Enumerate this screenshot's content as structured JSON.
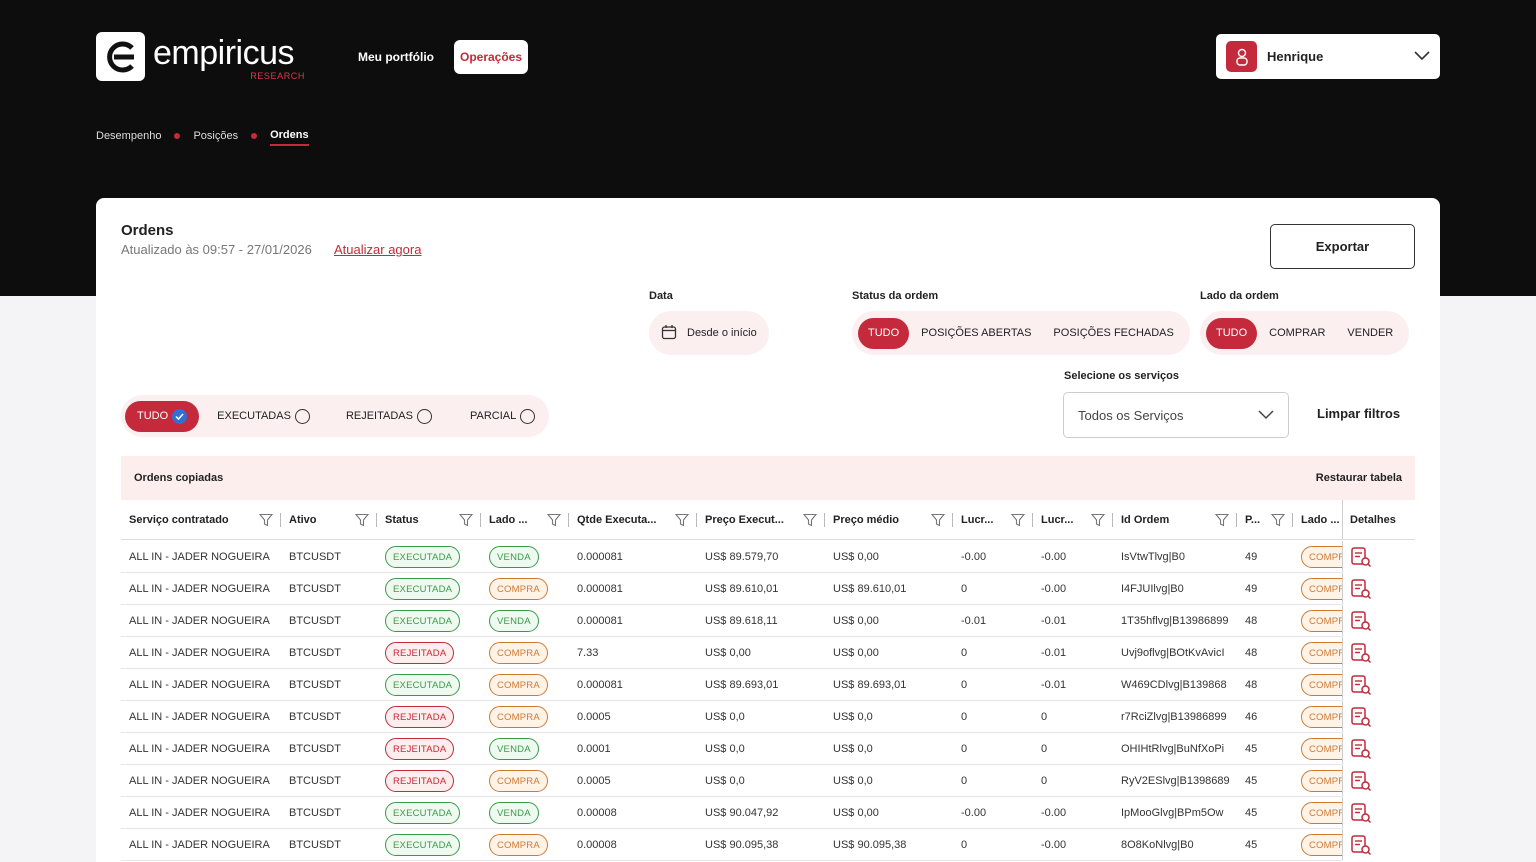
{
  "brand": {
    "name": "empiricus",
    "sub": "RESEARCH",
    "accent": "#c4293c"
  },
  "nav": {
    "portfolio": "Meu portfólio",
    "operacoes": "Operações"
  },
  "user": {
    "name": "Henrique"
  },
  "breadcrumb": {
    "b1": "Desempenho",
    "b2": "Posições",
    "b3": "Ordens"
  },
  "page": {
    "title": "Ordens",
    "updated": "Atualizado às 09:57 - 27/01/2026",
    "update_now": "Atualizar agora",
    "export": "Exportar"
  },
  "filters": {
    "data_label": "Data",
    "data_value": "Desde o início",
    "status_label": "Status da ordem",
    "status_options": [
      "TUDO",
      "POSIÇÕES ABERTAS",
      "POSIÇÕES FECHADAS"
    ],
    "lado_label": "Lado da ordem",
    "lado_options": [
      "TUDO",
      "COMPRAR",
      "VENDER"
    ],
    "exec_options": [
      "TUDO",
      "EXECUTADAS",
      "REJEITADAS",
      "PARCIAL"
    ],
    "services_label": "Selecione os serviços",
    "services_value": "Todos os Serviços",
    "clear": "Limpar filtros"
  },
  "table": {
    "caption": "Ordens copiadas",
    "restore": "Restaurar tabela",
    "columns": [
      "Serviço contratado",
      "Ativo",
      "Status",
      "Lado ...",
      "Qtde Executa...",
      "Preço Execut...",
      "Preço médio",
      "Lucr...",
      "Lucr...",
      "Id Ordem",
      "P...",
      "Lado ...",
      "Detalhes"
    ],
    "rows": [
      [
        "ALL IN - JADER NOGUEIRA",
        "BTCUSDT",
        "EXECUTADA",
        "VENDA",
        "0.000081",
        "US$ 89.579,70",
        "US$ 0,00",
        "-0.00",
        "-0.00",
        "IsVtwTlvg|B0",
        "49",
        "COMPRA"
      ],
      [
        "ALL IN - JADER NOGUEIRA",
        "BTCUSDT",
        "EXECUTADA",
        "COMPRA",
        "0.000081",
        "US$ 89.610,01",
        "US$ 89.610,01",
        "0",
        "-0.00",
        "I4FJUIlvg|B0",
        "49",
        "COMPRA"
      ],
      [
        "ALL IN - JADER NOGUEIRA",
        "BTCUSDT",
        "EXECUTADA",
        "VENDA",
        "0.000081",
        "US$ 89.618,11",
        "US$ 0,00",
        "-0.01",
        "-0.01",
        "1T35hflvg|B13986899",
        "48",
        "COMPRA"
      ],
      [
        "ALL IN - JADER NOGUEIRA",
        "BTCUSDT",
        "REJEITADA",
        "COMPRA",
        "7.33",
        "US$ 0,00",
        "US$ 0,00",
        "0",
        "-0.01",
        "Uvj9oflvg|BOtKvAvicI",
        "48",
        "COMPRA"
      ],
      [
        "ALL IN - JADER NOGUEIRA",
        "BTCUSDT",
        "EXECUTADA",
        "COMPRA",
        "0.000081",
        "US$ 89.693,01",
        "US$ 89.693,01",
        "0",
        "-0.01",
        "W469CDlvg|B139868",
        "48",
        "COMPRA"
      ],
      [
        "ALL IN - JADER NOGUEIRA",
        "BTCUSDT",
        "REJEITADA",
        "COMPRA",
        "0.0005",
        "US$ 0,0",
        "US$ 0,0",
        "0",
        "0",
        "r7RciZlvg|B13986899",
        "46",
        "COMPRA"
      ],
      [
        "ALL IN - JADER NOGUEIRA",
        "BTCUSDT",
        "REJEITADA",
        "VENDA",
        "0.0001",
        "US$ 0,0",
        "US$ 0,0",
        "0",
        "0",
        "OHIHtRlvg|BuNfXoPi",
        "45",
        "COMPRA"
      ],
      [
        "ALL IN - JADER NOGUEIRA",
        "BTCUSDT",
        "REJEITADA",
        "COMPRA",
        "0.0005",
        "US$ 0,0",
        "US$ 0,0",
        "0",
        "0",
        "RyV2ESlvg|B1398689",
        "45",
        "COMPRA"
      ],
      [
        "ALL IN - JADER NOGUEIRA",
        "BTCUSDT",
        "EXECUTADA",
        "VENDA",
        "0.00008",
        "US$ 90.047,92",
        "US$ 0,00",
        "-0.00",
        "-0.00",
        "IpMooGlvg|BPm5Ow",
        "45",
        "COMPRA"
      ],
      [
        "ALL IN - JADER NOGUEIRA",
        "BTCUSDT",
        "EXECUTADA",
        "COMPRA",
        "0.00008",
        "US$ 90.095,38",
        "US$ 90.095,38",
        "0",
        "-0.00",
        "8O8KoNlvg|B0",
        "45",
        "COMPRA"
      ]
    ]
  }
}
